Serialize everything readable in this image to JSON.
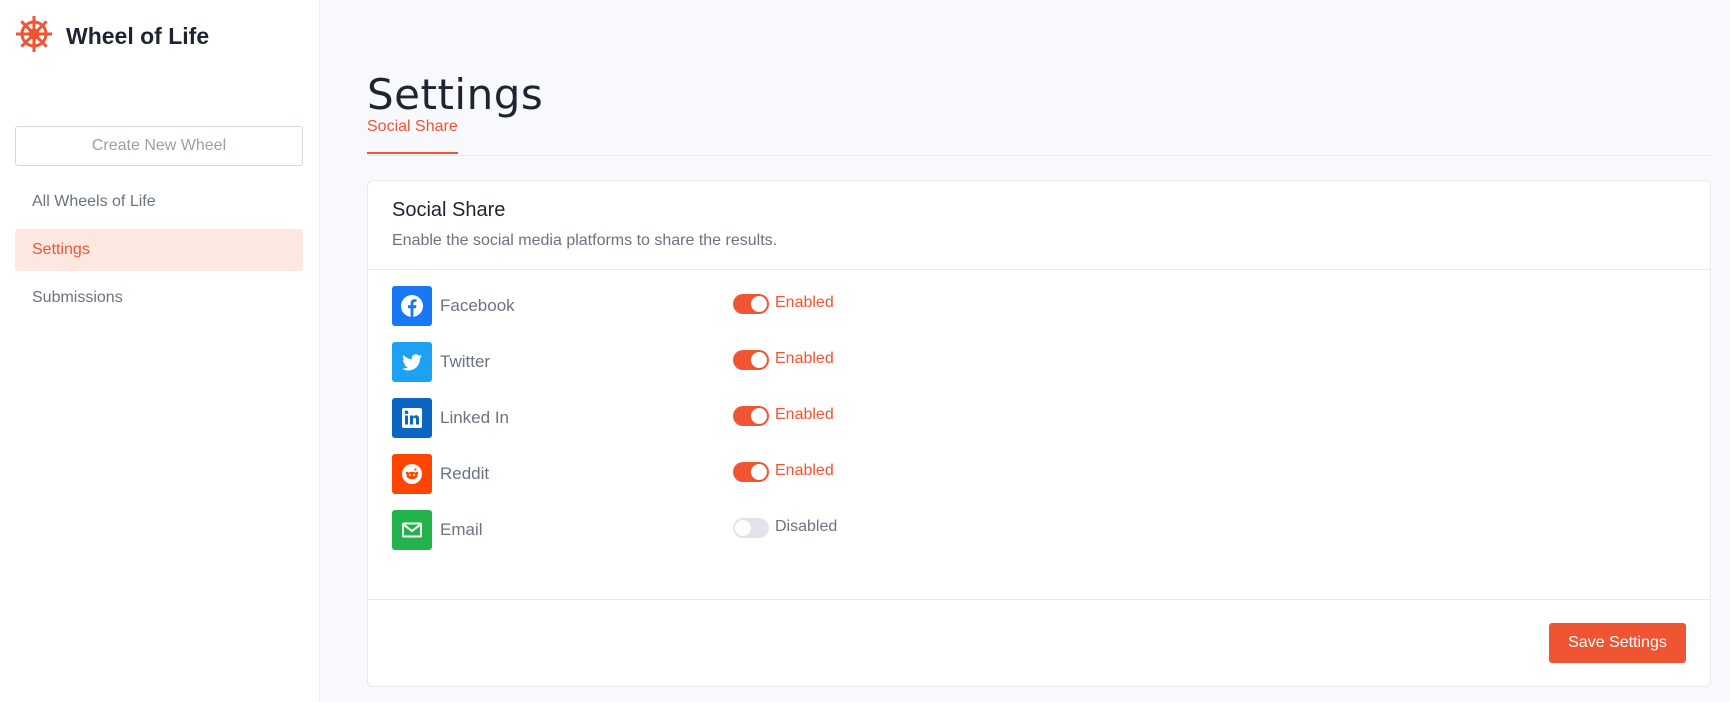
{
  "app": {
    "name": "Wheel of Life",
    "logo_icon": "ship-wheel-icon",
    "accent": "#ef5533"
  },
  "sidebar": {
    "create_button": "Create New Wheel",
    "items": [
      {
        "label": "All Wheels of Life",
        "active": false
      },
      {
        "label": "Settings",
        "active": true
      },
      {
        "label": "Submissions",
        "active": false
      }
    ]
  },
  "page": {
    "title": "Settings",
    "tabs": [
      {
        "label": "Social Share",
        "active": true
      }
    ]
  },
  "card": {
    "title": "Social Share",
    "description": "Enable the social media platforms to share the results.",
    "platforms": [
      {
        "name": "Facebook",
        "icon": "facebook-icon",
        "color": "#1877f2",
        "enabled": true,
        "status": "Enabled"
      },
      {
        "name": "Twitter",
        "icon": "twitter-icon",
        "color": "#1da1f2",
        "enabled": true,
        "status": "Enabled"
      },
      {
        "name": "Linked In",
        "icon": "linkedin-icon",
        "color": "#0a66c2",
        "enabled": true,
        "status": "Enabled"
      },
      {
        "name": "Reddit",
        "icon": "reddit-icon",
        "color": "#ff4500",
        "enabled": true,
        "status": "Enabled"
      },
      {
        "name": "Email",
        "icon": "email-icon",
        "color": "#22b44a",
        "enabled": false,
        "status": "Disabled"
      }
    ],
    "save_label": "Save Settings"
  }
}
